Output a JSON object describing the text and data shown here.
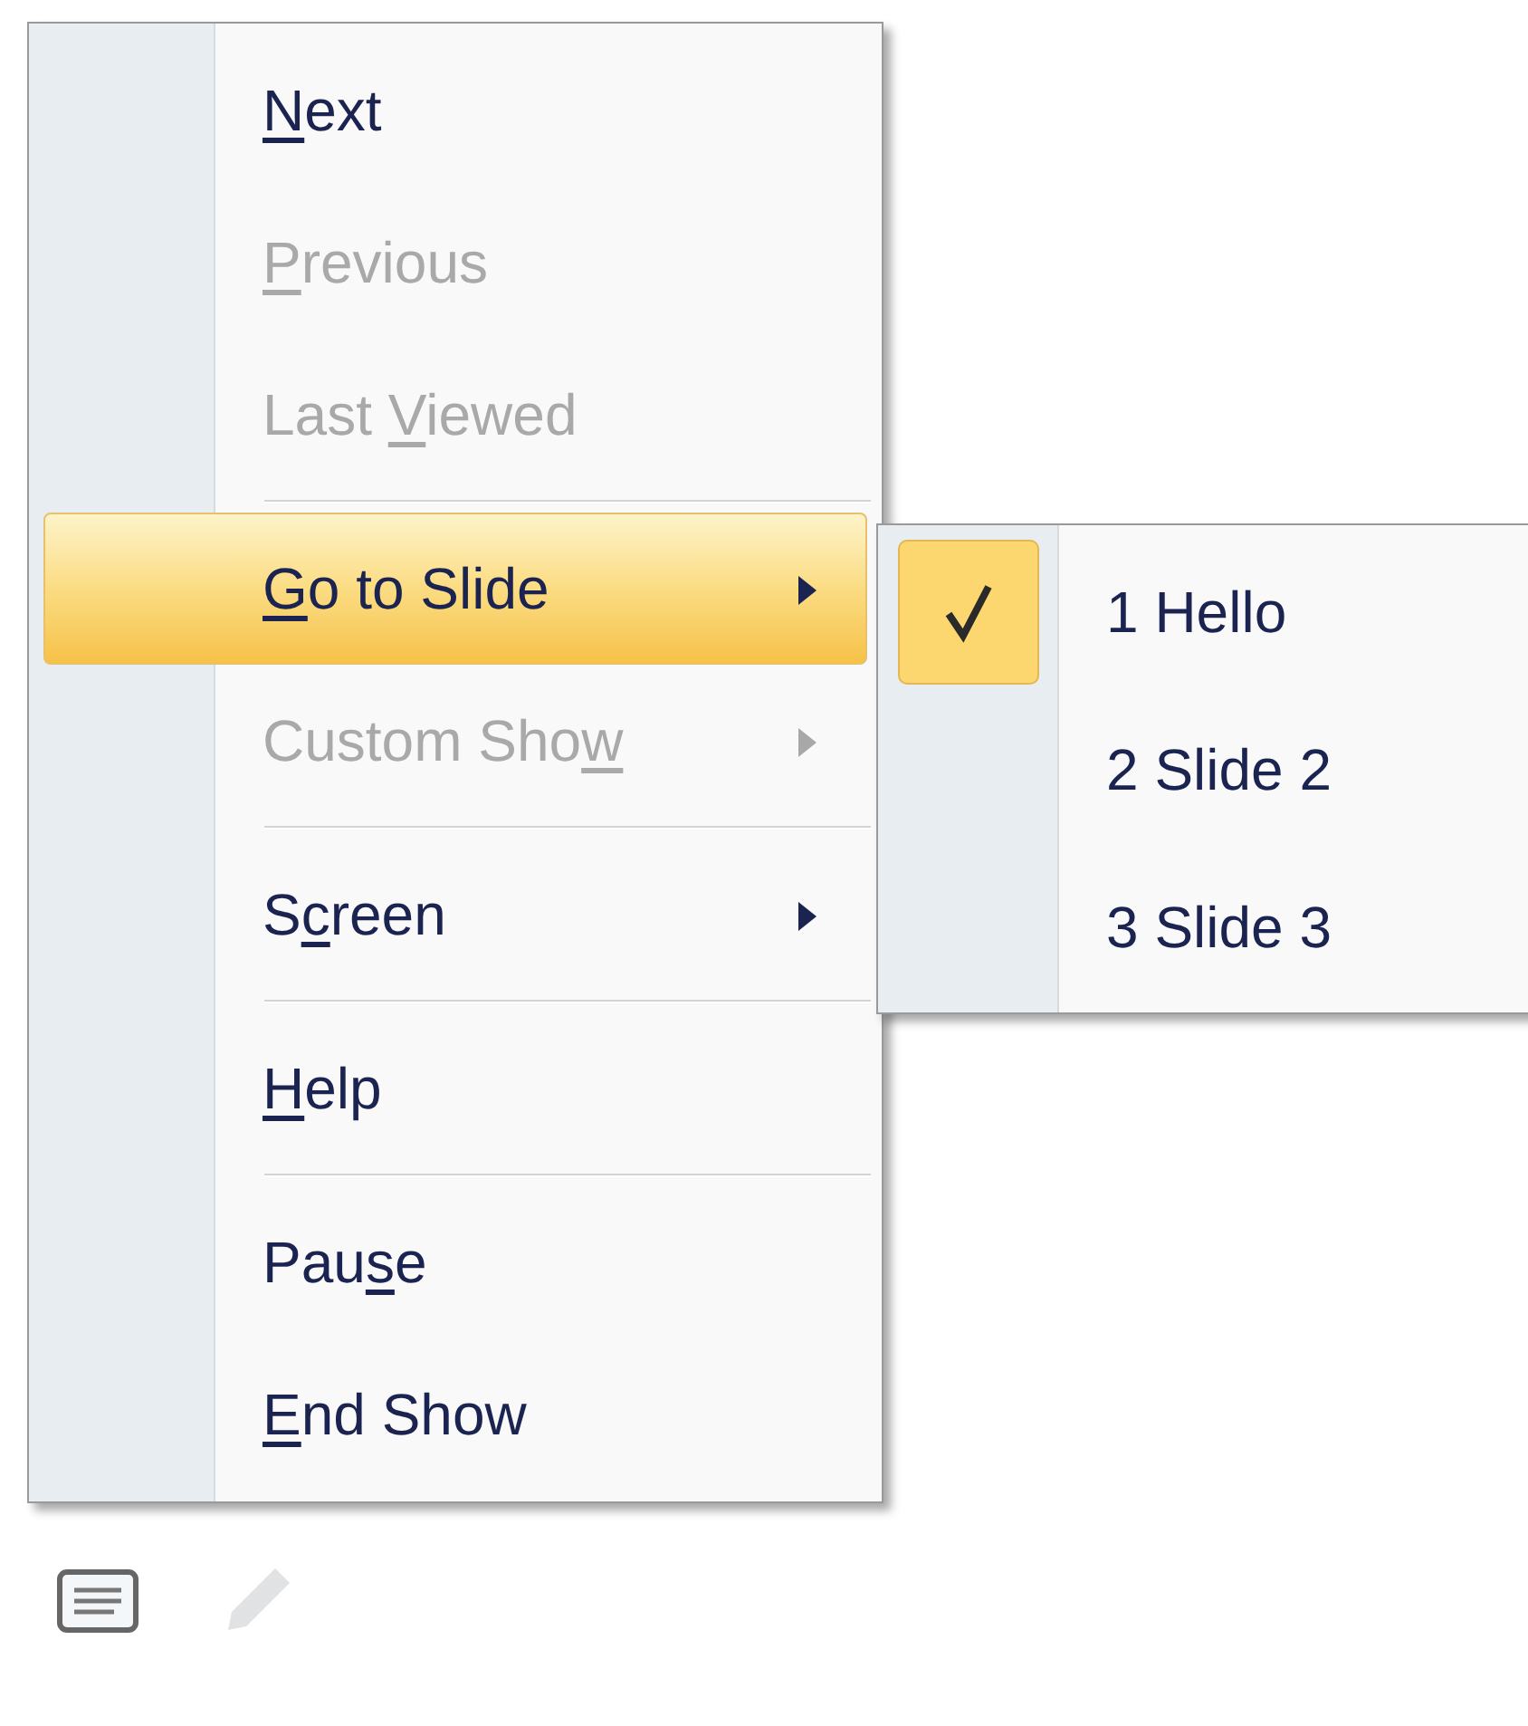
{
  "menu": {
    "items": [
      {
        "kind": "item",
        "label_parts": {
          "key": "N",
          "after": "ext"
        },
        "disabled": false,
        "selected": false,
        "submenu": false
      },
      {
        "kind": "item",
        "label_parts": {
          "key": "P",
          "after": "revious"
        },
        "disabled": true,
        "selected": false,
        "submenu": false
      },
      {
        "kind": "item",
        "label_parts": {
          "before": "Last ",
          "key": "V",
          "after": "iewed"
        },
        "disabled": true,
        "selected": false,
        "submenu": false
      },
      {
        "kind": "separator"
      },
      {
        "kind": "item",
        "label_parts": {
          "key": "G",
          "after": "o to Slide"
        },
        "disabled": false,
        "selected": true,
        "submenu": true
      },
      {
        "kind": "item",
        "label_parts": {
          "before": "Custom Sho",
          "key": "w"
        },
        "disabled": true,
        "selected": false,
        "submenu": true
      },
      {
        "kind": "separator"
      },
      {
        "kind": "item",
        "label_parts": {
          "before": "S",
          "key": "c",
          "after": "reen"
        },
        "disabled": false,
        "selected": false,
        "submenu": true
      },
      {
        "kind": "separator"
      },
      {
        "kind": "item",
        "label_parts": {
          "key": "H",
          "after": "elp"
        },
        "disabled": false,
        "selected": false,
        "submenu": false
      },
      {
        "kind": "separator"
      },
      {
        "kind": "item",
        "label_parts": {
          "before": "Pau",
          "key": "s",
          "after": "e"
        },
        "disabled": false,
        "selected": false,
        "submenu": false
      },
      {
        "kind": "item",
        "label_parts": {
          "key": "E",
          "after": "nd Show"
        },
        "disabled": false,
        "selected": false,
        "submenu": false
      }
    ]
  },
  "submenu": {
    "items": [
      {
        "label": "1 Hello",
        "checked": true
      },
      {
        "label": "2 Slide 2",
        "checked": false
      },
      {
        "label": "3 Slide 3",
        "checked": false
      }
    ]
  },
  "toolbar": {
    "items": [
      {
        "kind": "menu",
        "disabled": false
      },
      {
        "kind": "pen",
        "disabled": true
      }
    ]
  }
}
